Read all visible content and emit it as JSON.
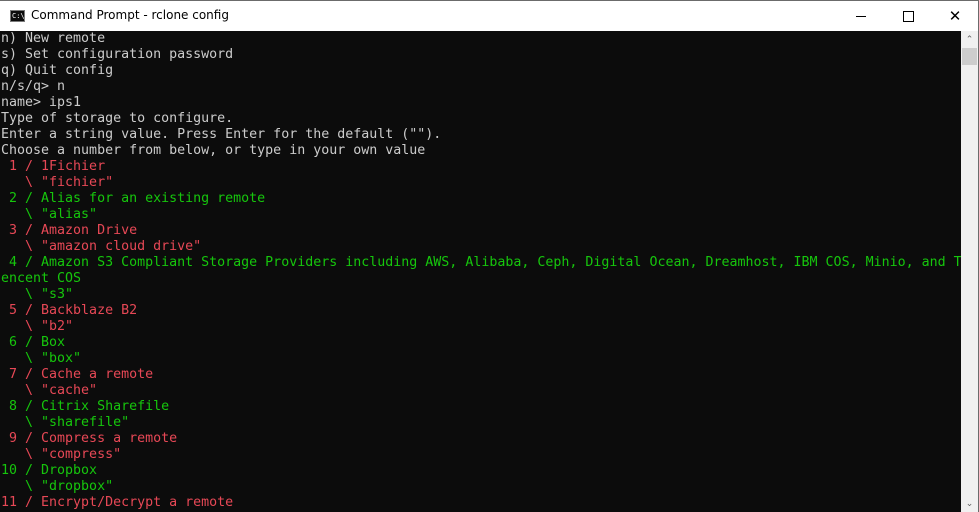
{
  "window": {
    "title": "Command Prompt - rclone  config",
    "icon": "cmd-icon",
    "icon_text": "C:\\_",
    "controls": {
      "minimize": "minimize-icon",
      "maximize": "maximize-icon",
      "close": "close-icon",
      "close_glyph": "✕"
    }
  },
  "colors": {
    "background": "#0c0c0c",
    "default_text": "#cccccc",
    "red": "#e74856",
    "green": "#16c60c"
  },
  "terminal": {
    "lines": [
      {
        "text": "n) New remote",
        "color": "default"
      },
      {
        "text": "s) Set configuration password",
        "color": "default"
      },
      {
        "text": "q) Quit config",
        "color": "default"
      },
      {
        "text": "n/s/q> n",
        "color": "default"
      },
      {
        "text": "name> ips1",
        "color": "default"
      },
      {
        "text": "Type of storage to configure.",
        "color": "default"
      },
      {
        "text": "Enter a string value. Press Enter for the default (\"\").",
        "color": "default"
      },
      {
        "text": "Choose a number from below, or type in your own value",
        "color": "default"
      },
      {
        "text": " 1 / 1Fichier",
        "color": "red"
      },
      {
        "text": "   \\ \"fichier\"",
        "color": "red"
      },
      {
        "text": " 2 / Alias for an existing remote",
        "color": "green"
      },
      {
        "text": "   \\ \"alias\"",
        "color": "green"
      },
      {
        "text": " 3 / Amazon Drive",
        "color": "red"
      },
      {
        "text": "   \\ \"amazon cloud drive\"",
        "color": "red"
      },
      {
        "text": " 4 / Amazon S3 Compliant Storage Providers including AWS, Alibaba, Ceph, Digital Ocean, Dreamhost, IBM COS, Minio, and T",
        "color": "green"
      },
      {
        "text": "encent COS",
        "color": "green"
      },
      {
        "text": "   \\ \"s3\"",
        "color": "green"
      },
      {
        "text": " 5 / Backblaze B2",
        "color": "red"
      },
      {
        "text": "   \\ \"b2\"",
        "color": "red"
      },
      {
        "text": " 6 / Box",
        "color": "green"
      },
      {
        "text": "   \\ \"box\"",
        "color": "green"
      },
      {
        "text": " 7 / Cache a remote",
        "color": "red"
      },
      {
        "text": "   \\ \"cache\"",
        "color": "red"
      },
      {
        "text": " 8 / Citrix Sharefile",
        "color": "green"
      },
      {
        "text": "   \\ \"sharefile\"",
        "color": "green"
      },
      {
        "text": " 9 / Compress a remote",
        "color": "red"
      },
      {
        "text": "   \\ \"compress\"",
        "color": "red"
      },
      {
        "text": "10 / Dropbox",
        "color": "green"
      },
      {
        "text": "   \\ \"dropbox\"",
        "color": "green"
      },
      {
        "text": "11 / Encrypt/Decrypt a remote",
        "color": "red"
      }
    ]
  },
  "scrollbar": {
    "up_glyph": "⌃",
    "down_glyph": "⌄",
    "position": 0.0
  }
}
